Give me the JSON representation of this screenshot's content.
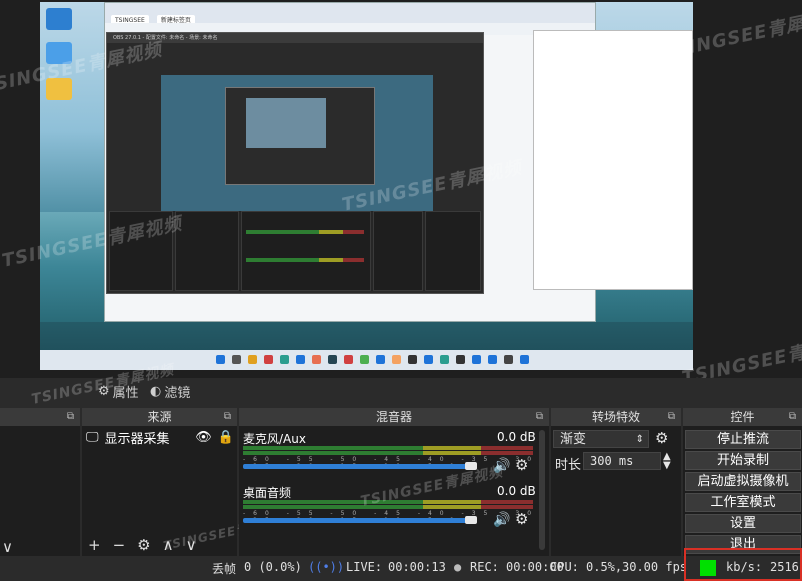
{
  "preview": {
    "watermark_text": "TSINGSEE青犀视频",
    "browser_tabs": [
      "TSINGSEE",
      "新建标签页"
    ],
    "inner_window_title": "OBS 27.0.1 - 配置文件: 未命名 - 场景: 未命名"
  },
  "filter_strip": {
    "properties_label": "属性",
    "filters_label": "滤镜"
  },
  "docks": {
    "sources": {
      "title": "来源",
      "item_label": "显示器采集"
    },
    "mixer": {
      "title": "混音器",
      "channels": [
        {
          "name": "麦克风/Aux",
          "db": "0.0 dB",
          "volume_fraction": 0.92
        },
        {
          "name": "桌面音频",
          "db": "0.0 dB",
          "volume_fraction": 0.92
        }
      ],
      "ticks": "-60 -55 -50 -45 -40 -35 -30 -25 -20 -15 -10 -5 0"
    },
    "transitions": {
      "title": "转场特效",
      "selected": "渐变",
      "duration_label": "时长",
      "duration_value": "300 ms"
    },
    "controls": {
      "title": "控件",
      "buttons": [
        "停止推流",
        "开始录制",
        "启动虚拟摄像机",
        "工作室模式",
        "设置",
        "退出"
      ]
    }
  },
  "status_bar": {
    "dropped_label": "丢帧",
    "dropped_value": "0 (0.0%)",
    "live_label": "LIVE:",
    "live_time": "00:00:13",
    "rec_label": "REC:",
    "rec_time": "00:00:00",
    "cpu_label": "CPU:",
    "cpu_value": "0.5%,",
    "fps_value": "30.00 fps",
    "kbps_label": "kb/s:",
    "kbps_value": "2516"
  },
  "colors": {
    "accent": "#2f7fd6",
    "status_green": "#00e000",
    "highlight_red": "#d93025"
  }
}
